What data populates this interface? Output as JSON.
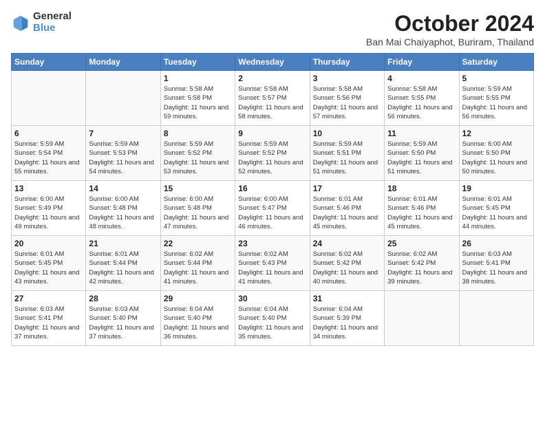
{
  "logo": {
    "general": "General",
    "blue": "Blue"
  },
  "title": {
    "month_year": "October 2024",
    "location": "Ban Mai Chaiyaphot, Buriram, Thailand"
  },
  "weekdays": [
    "Sunday",
    "Monday",
    "Tuesday",
    "Wednesday",
    "Thursday",
    "Friday",
    "Saturday"
  ],
  "weeks": [
    [
      {
        "day": "",
        "empty": true
      },
      {
        "day": "",
        "empty": true
      },
      {
        "day": "1",
        "sunrise": "5:58 AM",
        "sunset": "5:58 PM",
        "daylight": "11 hours and 59 minutes."
      },
      {
        "day": "2",
        "sunrise": "5:58 AM",
        "sunset": "5:57 PM",
        "daylight": "11 hours and 58 minutes."
      },
      {
        "day": "3",
        "sunrise": "5:58 AM",
        "sunset": "5:56 PM",
        "daylight": "11 hours and 57 minutes."
      },
      {
        "day": "4",
        "sunrise": "5:58 AM",
        "sunset": "5:55 PM",
        "daylight": "11 hours and 56 minutes."
      },
      {
        "day": "5",
        "sunrise": "5:59 AM",
        "sunset": "5:55 PM",
        "daylight": "11 hours and 56 minutes."
      }
    ],
    [
      {
        "day": "6",
        "sunrise": "5:59 AM",
        "sunset": "5:54 PM",
        "daylight": "11 hours and 55 minutes."
      },
      {
        "day": "7",
        "sunrise": "5:59 AM",
        "sunset": "5:53 PM",
        "daylight": "11 hours and 54 minutes."
      },
      {
        "day": "8",
        "sunrise": "5:59 AM",
        "sunset": "5:52 PM",
        "daylight": "11 hours and 53 minutes."
      },
      {
        "day": "9",
        "sunrise": "5:59 AM",
        "sunset": "5:52 PM",
        "daylight": "11 hours and 52 minutes."
      },
      {
        "day": "10",
        "sunrise": "5:59 AM",
        "sunset": "5:51 PM",
        "daylight": "11 hours and 51 minutes."
      },
      {
        "day": "11",
        "sunrise": "5:59 AM",
        "sunset": "5:50 PM",
        "daylight": "11 hours and 51 minutes."
      },
      {
        "day": "12",
        "sunrise": "6:00 AM",
        "sunset": "5:50 PM",
        "daylight": "11 hours and 50 minutes."
      }
    ],
    [
      {
        "day": "13",
        "sunrise": "6:00 AM",
        "sunset": "5:49 PM",
        "daylight": "11 hours and 49 minutes."
      },
      {
        "day": "14",
        "sunrise": "6:00 AM",
        "sunset": "5:48 PM",
        "daylight": "11 hours and 48 minutes."
      },
      {
        "day": "15",
        "sunrise": "6:00 AM",
        "sunset": "5:48 PM",
        "daylight": "11 hours and 47 minutes."
      },
      {
        "day": "16",
        "sunrise": "6:00 AM",
        "sunset": "5:47 PM",
        "daylight": "11 hours and 46 minutes."
      },
      {
        "day": "17",
        "sunrise": "6:01 AM",
        "sunset": "5:46 PM",
        "daylight": "11 hours and 45 minutes."
      },
      {
        "day": "18",
        "sunrise": "6:01 AM",
        "sunset": "5:46 PM",
        "daylight": "11 hours and 45 minutes."
      },
      {
        "day": "19",
        "sunrise": "6:01 AM",
        "sunset": "5:45 PM",
        "daylight": "11 hours and 44 minutes."
      }
    ],
    [
      {
        "day": "20",
        "sunrise": "6:01 AM",
        "sunset": "5:45 PM",
        "daylight": "11 hours and 43 minutes."
      },
      {
        "day": "21",
        "sunrise": "6:01 AM",
        "sunset": "5:44 PM",
        "daylight": "11 hours and 42 minutes."
      },
      {
        "day": "22",
        "sunrise": "6:02 AM",
        "sunset": "5:44 PM",
        "daylight": "11 hours and 41 minutes."
      },
      {
        "day": "23",
        "sunrise": "6:02 AM",
        "sunset": "5:43 PM",
        "daylight": "11 hours and 41 minutes."
      },
      {
        "day": "24",
        "sunrise": "6:02 AM",
        "sunset": "5:42 PM",
        "daylight": "11 hours and 40 minutes."
      },
      {
        "day": "25",
        "sunrise": "6:02 AM",
        "sunset": "5:42 PM",
        "daylight": "11 hours and 39 minutes."
      },
      {
        "day": "26",
        "sunrise": "6:03 AM",
        "sunset": "5:41 PM",
        "daylight": "11 hours and 38 minutes."
      }
    ],
    [
      {
        "day": "27",
        "sunrise": "6:03 AM",
        "sunset": "5:41 PM",
        "daylight": "11 hours and 37 minutes."
      },
      {
        "day": "28",
        "sunrise": "6:03 AM",
        "sunset": "5:40 PM",
        "daylight": "11 hours and 37 minutes."
      },
      {
        "day": "29",
        "sunrise": "6:04 AM",
        "sunset": "5:40 PM",
        "daylight": "11 hours and 36 minutes."
      },
      {
        "day": "30",
        "sunrise": "6:04 AM",
        "sunset": "5:40 PM",
        "daylight": "11 hours and 35 minutes."
      },
      {
        "day": "31",
        "sunrise": "6:04 AM",
        "sunset": "5:39 PM",
        "daylight": "11 hours and 34 minutes."
      },
      {
        "day": "",
        "empty": true
      },
      {
        "day": "",
        "empty": true
      }
    ]
  ]
}
